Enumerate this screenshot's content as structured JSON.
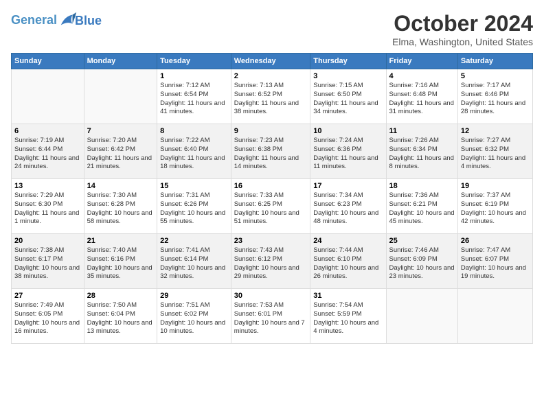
{
  "header": {
    "logo_line1": "General",
    "logo_line2": "Blue",
    "month_title": "October 2024",
    "location": "Elma, Washington, United States"
  },
  "weekdays": [
    "Sunday",
    "Monday",
    "Tuesday",
    "Wednesday",
    "Thursday",
    "Friday",
    "Saturday"
  ],
  "weeks": [
    [
      {
        "day": "",
        "info": ""
      },
      {
        "day": "",
        "info": ""
      },
      {
        "day": "1",
        "info": "Sunrise: 7:12 AM\nSunset: 6:54 PM\nDaylight: 11 hours and 41 minutes."
      },
      {
        "day": "2",
        "info": "Sunrise: 7:13 AM\nSunset: 6:52 PM\nDaylight: 11 hours and 38 minutes."
      },
      {
        "day": "3",
        "info": "Sunrise: 7:15 AM\nSunset: 6:50 PM\nDaylight: 11 hours and 34 minutes."
      },
      {
        "day": "4",
        "info": "Sunrise: 7:16 AM\nSunset: 6:48 PM\nDaylight: 11 hours and 31 minutes."
      },
      {
        "day": "5",
        "info": "Sunrise: 7:17 AM\nSunset: 6:46 PM\nDaylight: 11 hours and 28 minutes."
      }
    ],
    [
      {
        "day": "6",
        "info": "Sunrise: 7:19 AM\nSunset: 6:44 PM\nDaylight: 11 hours and 24 minutes."
      },
      {
        "day": "7",
        "info": "Sunrise: 7:20 AM\nSunset: 6:42 PM\nDaylight: 11 hours and 21 minutes."
      },
      {
        "day": "8",
        "info": "Sunrise: 7:22 AM\nSunset: 6:40 PM\nDaylight: 11 hours and 18 minutes."
      },
      {
        "day": "9",
        "info": "Sunrise: 7:23 AM\nSunset: 6:38 PM\nDaylight: 11 hours and 14 minutes."
      },
      {
        "day": "10",
        "info": "Sunrise: 7:24 AM\nSunset: 6:36 PM\nDaylight: 11 hours and 11 minutes."
      },
      {
        "day": "11",
        "info": "Sunrise: 7:26 AM\nSunset: 6:34 PM\nDaylight: 11 hours and 8 minutes."
      },
      {
        "day": "12",
        "info": "Sunrise: 7:27 AM\nSunset: 6:32 PM\nDaylight: 11 hours and 4 minutes."
      }
    ],
    [
      {
        "day": "13",
        "info": "Sunrise: 7:29 AM\nSunset: 6:30 PM\nDaylight: 11 hours and 1 minute."
      },
      {
        "day": "14",
        "info": "Sunrise: 7:30 AM\nSunset: 6:28 PM\nDaylight: 10 hours and 58 minutes."
      },
      {
        "day": "15",
        "info": "Sunrise: 7:31 AM\nSunset: 6:26 PM\nDaylight: 10 hours and 55 minutes."
      },
      {
        "day": "16",
        "info": "Sunrise: 7:33 AM\nSunset: 6:25 PM\nDaylight: 10 hours and 51 minutes."
      },
      {
        "day": "17",
        "info": "Sunrise: 7:34 AM\nSunset: 6:23 PM\nDaylight: 10 hours and 48 minutes."
      },
      {
        "day": "18",
        "info": "Sunrise: 7:36 AM\nSunset: 6:21 PM\nDaylight: 10 hours and 45 minutes."
      },
      {
        "day": "19",
        "info": "Sunrise: 7:37 AM\nSunset: 6:19 PM\nDaylight: 10 hours and 42 minutes."
      }
    ],
    [
      {
        "day": "20",
        "info": "Sunrise: 7:38 AM\nSunset: 6:17 PM\nDaylight: 10 hours and 38 minutes."
      },
      {
        "day": "21",
        "info": "Sunrise: 7:40 AM\nSunset: 6:16 PM\nDaylight: 10 hours and 35 minutes."
      },
      {
        "day": "22",
        "info": "Sunrise: 7:41 AM\nSunset: 6:14 PM\nDaylight: 10 hours and 32 minutes."
      },
      {
        "day": "23",
        "info": "Sunrise: 7:43 AM\nSunset: 6:12 PM\nDaylight: 10 hours and 29 minutes."
      },
      {
        "day": "24",
        "info": "Sunrise: 7:44 AM\nSunset: 6:10 PM\nDaylight: 10 hours and 26 minutes."
      },
      {
        "day": "25",
        "info": "Sunrise: 7:46 AM\nSunset: 6:09 PM\nDaylight: 10 hours and 23 minutes."
      },
      {
        "day": "26",
        "info": "Sunrise: 7:47 AM\nSunset: 6:07 PM\nDaylight: 10 hours and 19 minutes."
      }
    ],
    [
      {
        "day": "27",
        "info": "Sunrise: 7:49 AM\nSunset: 6:05 PM\nDaylight: 10 hours and 16 minutes."
      },
      {
        "day": "28",
        "info": "Sunrise: 7:50 AM\nSunset: 6:04 PM\nDaylight: 10 hours and 13 minutes."
      },
      {
        "day": "29",
        "info": "Sunrise: 7:51 AM\nSunset: 6:02 PM\nDaylight: 10 hours and 10 minutes."
      },
      {
        "day": "30",
        "info": "Sunrise: 7:53 AM\nSunset: 6:01 PM\nDaylight: 10 hours and 7 minutes."
      },
      {
        "day": "31",
        "info": "Sunrise: 7:54 AM\nSunset: 5:59 PM\nDaylight: 10 hours and 4 minutes."
      },
      {
        "day": "",
        "info": ""
      },
      {
        "day": "",
        "info": ""
      }
    ]
  ]
}
